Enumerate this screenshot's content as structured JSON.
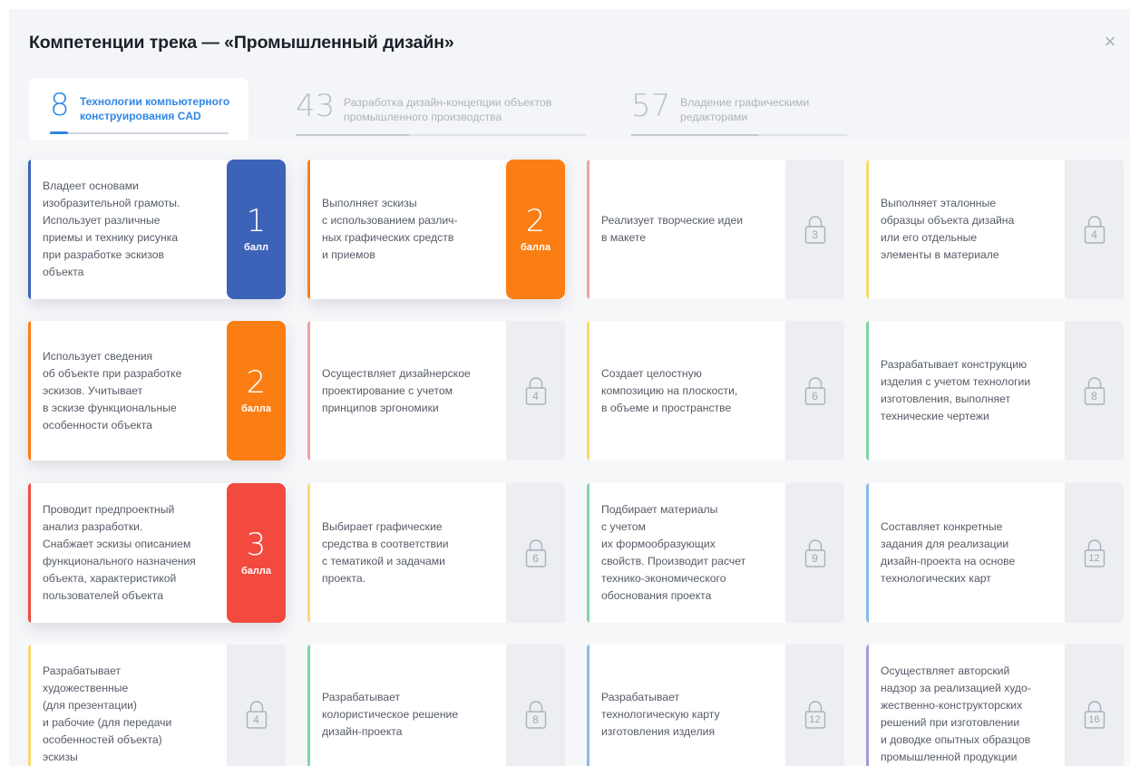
{
  "modal": {
    "title": "Компетенции трека — «Промышленный дизайн»",
    "close_icon": "×"
  },
  "tabs": [
    {
      "number": "8",
      "label_line1": "Технологии компьютерного",
      "label_line2": "конструирования CAD",
      "active": true
    },
    {
      "number": "43",
      "label_line1": "Разработка дизайн-концепции объектов",
      "label_line2": "промышленного производства",
      "active": false
    },
    {
      "number": "57",
      "label_line1": "Владение графическими",
      "label_line2": "редакторами",
      "active": false
    }
  ],
  "colors": {
    "blue": "#3d63b8",
    "orange": "#fb7e14",
    "red": "#f24a3f",
    "pink": "#f2a0a0",
    "yellow": "#fad872",
    "green": "#7ed6a3",
    "lightblue": "#8ab9ec",
    "purple": "#a997d3",
    "accent": "#2f86e6"
  },
  "cards": [
    {
      "lines": [
        "Владеет основами",
        "изобразительной грамоты.",
        "Использует различные",
        "приемы и технику рисунка",
        "при разработке эскизов",
        "объекта"
      ],
      "state": "unlocked",
      "score": "1",
      "score_label": "балл",
      "color": "blue"
    },
    {
      "lines": [
        "Выполняет эскизы",
        "с использованием различ-",
        "ных графических средств",
        "и приемов"
      ],
      "state": "unlocked",
      "score": "2",
      "score_label": "балла",
      "color": "orange"
    },
    {
      "lines": [
        "Реализует творческие идеи",
        "в макете"
      ],
      "state": "locked",
      "level": "3",
      "color": "pink"
    },
    {
      "lines": [
        "Выполняет эталонные",
        "образцы объекта дизайна",
        "или его отдельные",
        "элементы в материале"
      ],
      "state": "locked",
      "level": "4",
      "color": "yellow"
    },
    {
      "lines": [
        "Использует сведения",
        "об объекте при разработке",
        "эскизов. Учитывает",
        "в эскизе функциональные",
        "особенности объекта"
      ],
      "state": "unlocked",
      "score": "2",
      "score_label": "балла",
      "color": "orange"
    },
    {
      "lines": [
        "Осуществляет дизайнерское",
        "проектирование с учетом",
        "принципов эргономики"
      ],
      "state": "locked",
      "level": "4",
      "color": "pink"
    },
    {
      "lines": [
        "Создает целостную",
        "композицию на плоскости,",
        "в объеме и пространстве"
      ],
      "state": "locked",
      "level": "6",
      "color": "yellow"
    },
    {
      "lines": [
        "Разрабатывает конструкцию",
        "изделия с учетом технологии",
        "изготовления, выполняет",
        "технические чертежи"
      ],
      "state": "locked",
      "level": "8",
      "color": "green"
    },
    {
      "lines": [
        "Проводит предпроектный",
        "анализ разработки.",
        "Снабжает эскизы описанием",
        "функционального назначения",
        "объекта, характеристикой",
        "пользователей объекта"
      ],
      "state": "unlocked",
      "score": "3",
      "score_label": "балла",
      "color": "red"
    },
    {
      "lines": [
        "Выбирает графические",
        "средства в соответствии",
        "с тематикой и задачами",
        "проекта."
      ],
      "state": "locked",
      "level": "6",
      "color": "yellow"
    },
    {
      "lines": [
        "Подбирает материалы",
        "с учетом",
        "их формообразующих",
        "свойств. Производит расчет",
        "технико-экономического",
        "обоснования проекта"
      ],
      "state": "locked",
      "level": "9",
      "color": "green"
    },
    {
      "lines": [
        "Составляет конкретные",
        "задания для реализации",
        "дизайн-проекта на основе",
        "технологических карт"
      ],
      "state": "locked",
      "level": "12",
      "color": "lightblue"
    },
    {
      "lines": [
        "Разрабатывает",
        "художественные",
        "(для презентации)",
        "и рабочие (для передачи",
        "особенностей объекта)",
        "эскизы"
      ],
      "state": "locked",
      "level": "4",
      "color": "yellow"
    },
    {
      "lines": [
        "Разрабатывает",
        "колористическое решение",
        "дизайн-проекта"
      ],
      "state": "locked",
      "level": "8",
      "color": "green"
    },
    {
      "lines": [
        "Разрабатывает",
        "технологическую карту",
        "изготовления изделия"
      ],
      "state": "locked",
      "level": "12",
      "color": "lightblue"
    },
    {
      "lines": [
        "Осуществляет авторский",
        "надзор за реализацией худо-",
        "жественно-конструкторских",
        "решений при изготовлении",
        "и доводке опытных образцов",
        "промышленной продукции"
      ],
      "state": "locked",
      "level": "16",
      "color": "purple"
    }
  ]
}
